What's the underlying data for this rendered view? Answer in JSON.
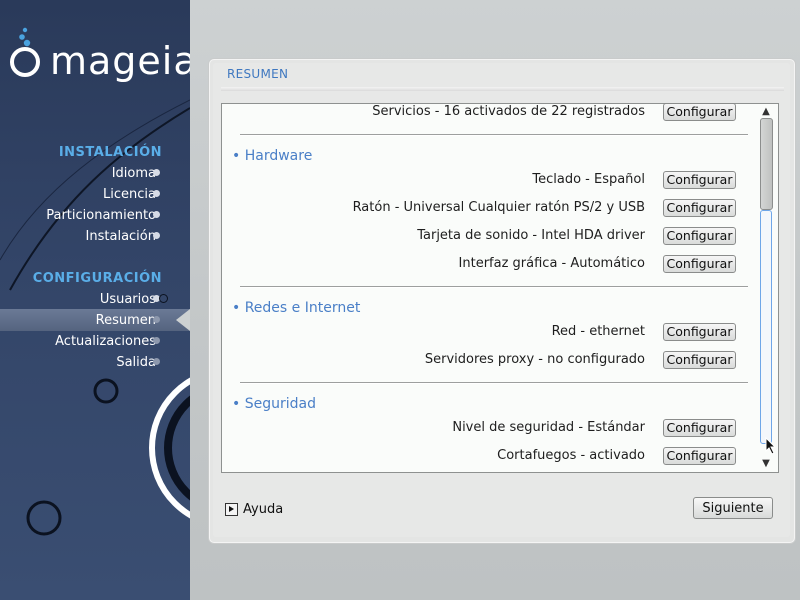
{
  "sidebar": {
    "logo_text": "mageia",
    "sections": [
      {
        "title": "INSTALACIÓN",
        "items": [
          {
            "label": "Idioma",
            "state": "done"
          },
          {
            "label": "Licencia",
            "state": "done"
          },
          {
            "label": "Particionamiento",
            "state": "done"
          },
          {
            "label": "Instalación",
            "state": "done"
          }
        ]
      },
      {
        "title": "CONFIGURACIÓN",
        "items": [
          {
            "label": "Usuarios",
            "state": "done"
          },
          {
            "label": "Resumen",
            "state": "active"
          },
          {
            "label": "Actualizaciones",
            "state": "pending"
          },
          {
            "label": "Salida",
            "state": "pending"
          }
        ]
      }
    ]
  },
  "summary": {
    "title": "RESUMEN",
    "top_row": {
      "label": "Servicios - 16 activados de 22 registrados",
      "button": "Configurar"
    },
    "groups": [
      {
        "title": "• Hardware",
        "rows": [
          {
            "label": "Teclado - Español",
            "button": "Configurar"
          },
          {
            "label": "Ratón - Universal Cualquier ratón PS/2 y USB",
            "button": "Configurar"
          },
          {
            "label": "Tarjeta de sonido - Intel HDA driver",
            "button": "Configurar"
          },
          {
            "label": "Interfaz gráfica - Automático",
            "button": "Configurar"
          }
        ]
      },
      {
        "title": "• Redes e Internet",
        "rows": [
          {
            "label": "Red - ethernet",
            "button": "Configurar"
          },
          {
            "label": "Servidores proxy - no configurado",
            "button": "Configurar"
          }
        ]
      },
      {
        "title": "• Seguridad",
        "rows": [
          {
            "label": "Nivel de seguridad - Estándar",
            "button": "Configurar"
          },
          {
            "label": "Cortafuegos - activado",
            "button": "Configurar"
          }
        ]
      }
    ]
  },
  "footer": {
    "help_label": "Ayuda",
    "next_label": "Siguiente"
  },
  "colors": {
    "accent": "#4a7fc7",
    "sidebar_heading": "#5aaee8",
    "sidebar_bg": "#334568"
  },
  "icons": {
    "help": "triangle-right-icon",
    "logo": "mageia-cauldron-icon",
    "cursor": "mouse-pointer-icon"
  }
}
